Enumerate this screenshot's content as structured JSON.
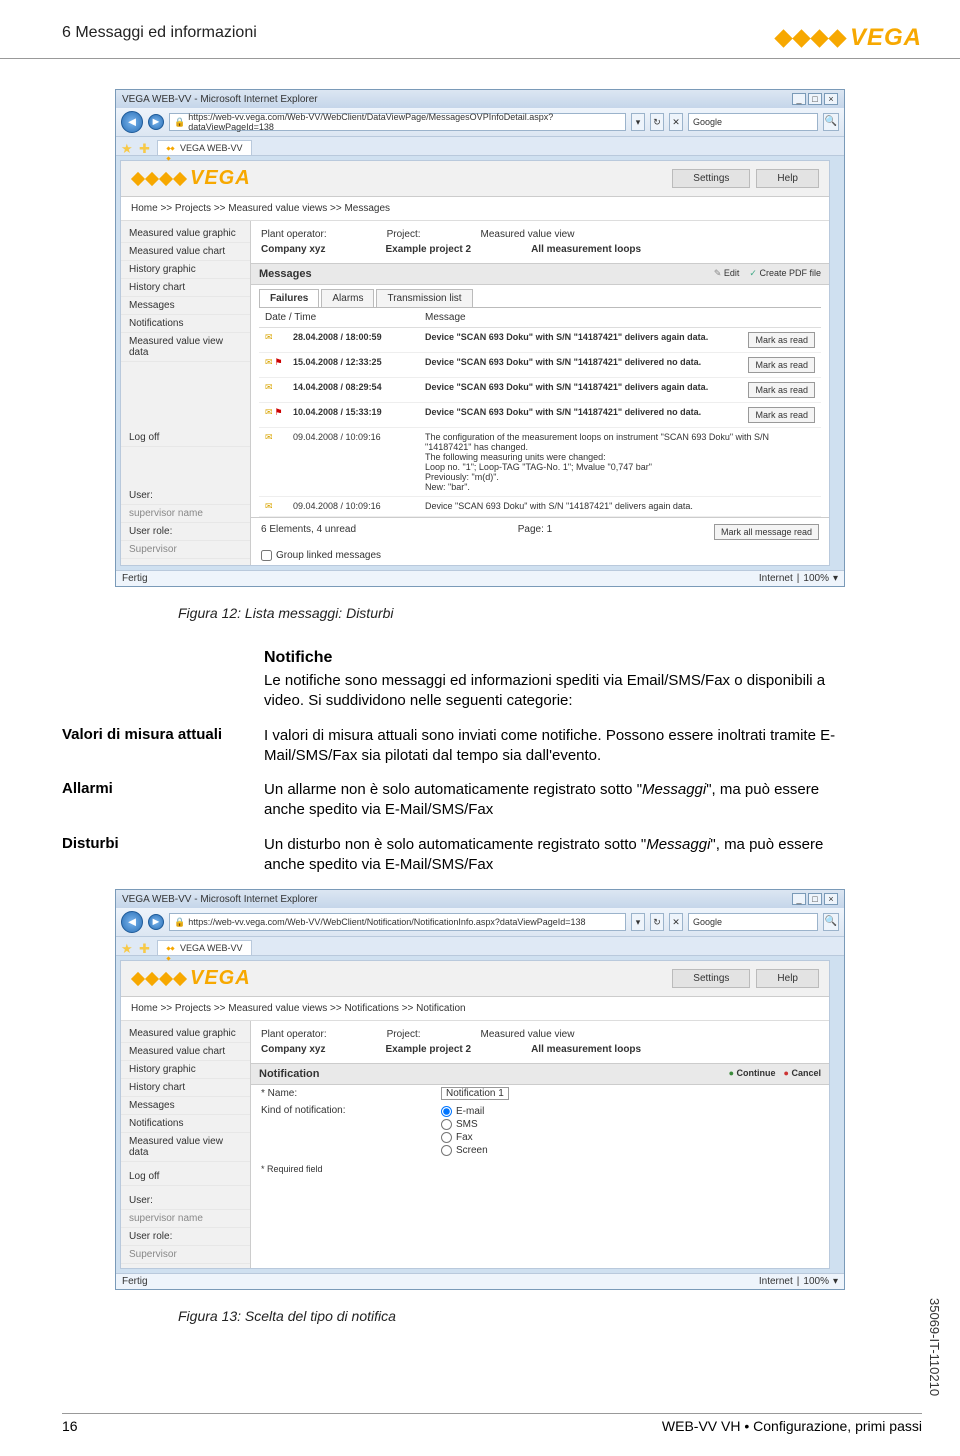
{
  "header": {
    "section": "6  Messaggi ed informazioni"
  },
  "logo": {
    "text": "VEGA"
  },
  "shot1": {
    "window_title": "VEGA WEB-VV - Microsoft Internet Explorer",
    "url": "https://web-vv.vega.com/Web-VV/WebClient/DataViewPage/MessagesOVPInfoDetail.aspx?dataViewPageId=138",
    "search_provider": "Google",
    "tab": "VEGA WEB-VV",
    "brand_btns": {
      "settings": "Settings",
      "help": "Help"
    },
    "crumbs": "Home >> Projects >> Measured value views >> Messages",
    "sidebar": [
      "Measured value graphic",
      "Measured value chart",
      "History graphic",
      "History chart",
      "Messages",
      "Notifications",
      "Measured value view data"
    ],
    "logoff": "Log off",
    "user_label": "User:",
    "user_name": "supervisor name",
    "userrole_label": "User role:",
    "userrole_val": "Supervisor",
    "info": {
      "op_label": "Plant operator:",
      "op_val": "Company xyz",
      "proj_label": "Project:",
      "proj_val": "Example project 2",
      "mv_label": "Measured value view",
      "mv_val": "All measurement loops"
    },
    "panel_title": "Messages",
    "actions": {
      "edit": "Edit",
      "pdf": "Create PDF file"
    },
    "subtabs": {
      "fail": "Failures",
      "alarm": "Alarms",
      "trans": "Transmission list"
    },
    "thead": {
      "dt": "Date / Time",
      "msg": "Message"
    },
    "rows": [
      {
        "dt": "28.04.2008 / 18:00:59",
        "msg": "Device \"SCAN 693 Doku\" with S/N \"14187421\" delivers again data.",
        "btn": "Mark as read",
        "flag": false
      },
      {
        "dt": "15.04.2008 / 12:33:25",
        "msg": "Device \"SCAN 693 Doku\" with S/N \"14187421\" delivered no data.",
        "btn": "Mark as read",
        "flag": true
      },
      {
        "dt": "14.04.2008 / 08:29:54",
        "msg": "Device \"SCAN 693 Doku\" with S/N \"14187421\" delivers again data.",
        "btn": "Mark as read",
        "flag": false
      },
      {
        "dt": "10.04.2008 / 15:33:19",
        "msg": "Device \"SCAN 693 Doku\" with S/N \"14187421\" delivered no data.",
        "btn": "Mark as read",
        "flag": true
      },
      {
        "dt": "09.04.2008 / 10:09:16",
        "msg": "The configuration of the measurement loops on instrument \"SCAN 693 Doku\" with S/N \"14187421\" has changed.\nThe following measuring units were changed:\nLoop no. \"1\"; Loop-TAG \"TAG-No. 1\"; Mvalue \"0,747 bar\"\nPreviously: \"m(d)\".\nNew: \"bar\".",
        "btn": "",
        "flag": false,
        "nobold": true
      },
      {
        "dt": "09.04.2008 / 10:09:16",
        "msg": "Device \"SCAN 693 Doku\" with S/N \"14187421\" delivers again data.",
        "btn": "",
        "flag": false,
        "nobold": true
      }
    ],
    "footer2": {
      "count": "6 Elements, 4 unread",
      "page": "Page: 1",
      "markall": "Mark all message read"
    },
    "chk": "Group linked messages",
    "status_left": "Fertig",
    "status_net": "Internet",
    "status_zoom": "100%"
  },
  "caption1": "Figura 12: Lista messaggi: Disturbi",
  "notif": {
    "title": "Notifiche",
    "intro": "Le notifiche sono messaggi ed informazioni spediti via Email/SMS/Fax o disponibili a video. Si suddividono nelle seguenti categorie:",
    "defs": [
      {
        "label": "Valori di misura attuali",
        "body": "I valori di misura attuali sono inviati come notifiche. Possono essere inoltrati tramite E-Mail/SMS/Fax sia pilotati dal tempo sia dall'evento."
      },
      {
        "label": "Allarmi",
        "body": "Un allarme non è solo automaticamente registrato sotto \"<i>Messaggi</i>\", ma può essere anche spedito via E-Mail/SMS/Fax"
      },
      {
        "label": "Disturbi",
        "body": "Un disturbo non è solo automaticamente registrato sotto \"<i>Messaggi</i>\", ma può essere anche spedito via E-Mail/SMS/Fax"
      }
    ]
  },
  "shot2": {
    "window_title": "VEGA WEB-VV - Microsoft Internet Explorer",
    "url": "https://web-vv.vega.com/Web-VV/WebClient/Notification/NotificationInfo.aspx?dataViewPageId=138",
    "search_provider": "Google",
    "tab": "VEGA WEB-VV",
    "crumbs": "Home >> Projects >> Measured value views >> Notifications >> Notification",
    "panel_title": "Notification",
    "cont": "Continue",
    "canc": "Cancel",
    "name_lab": "* Name:",
    "name_val": "Notification 1",
    "kind_lab": "Kind of notification:",
    "opts": [
      "E-mail",
      "SMS",
      "Fax",
      "Screen"
    ],
    "req": "*   Required field"
  },
  "caption2": "Figura 13: Scelta del tipo di notifica",
  "sidecode": "35069-IT-110210",
  "pagenum": "16",
  "pagefoot": "WEB-VV VH • Configurazione, primi passi"
}
